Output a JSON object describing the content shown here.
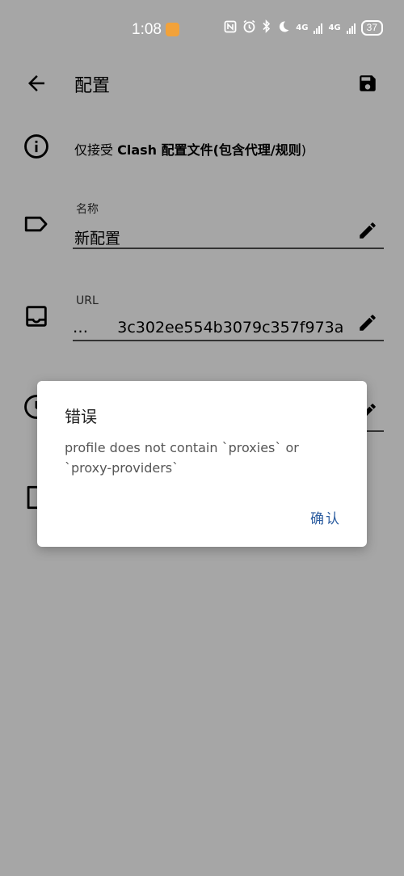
{
  "status_bar": {
    "time": "1:08",
    "network_1": "4G",
    "network_2": "4G",
    "battery": "37"
  },
  "app_bar": {
    "title": "配置"
  },
  "info": {
    "prefix": "仅接受 ",
    "clash": "Clash",
    "middle": " 配置文件(包含",
    "proxy_rules": "代理/规则",
    "suffix": ")"
  },
  "name_field": {
    "label": "名称",
    "value": "新配置"
  },
  "url_field": {
    "label": "URL",
    "value": "…      3c302ee554b3079c357f973a"
  },
  "dialog": {
    "title": "错误",
    "message": "profile does not contain `proxies` or `proxy-providers`",
    "confirm": "确认"
  },
  "colors": {
    "scrim_background": "#a6a6a6",
    "dialog_background": "#ffffff",
    "accent": "#2c5da0"
  }
}
